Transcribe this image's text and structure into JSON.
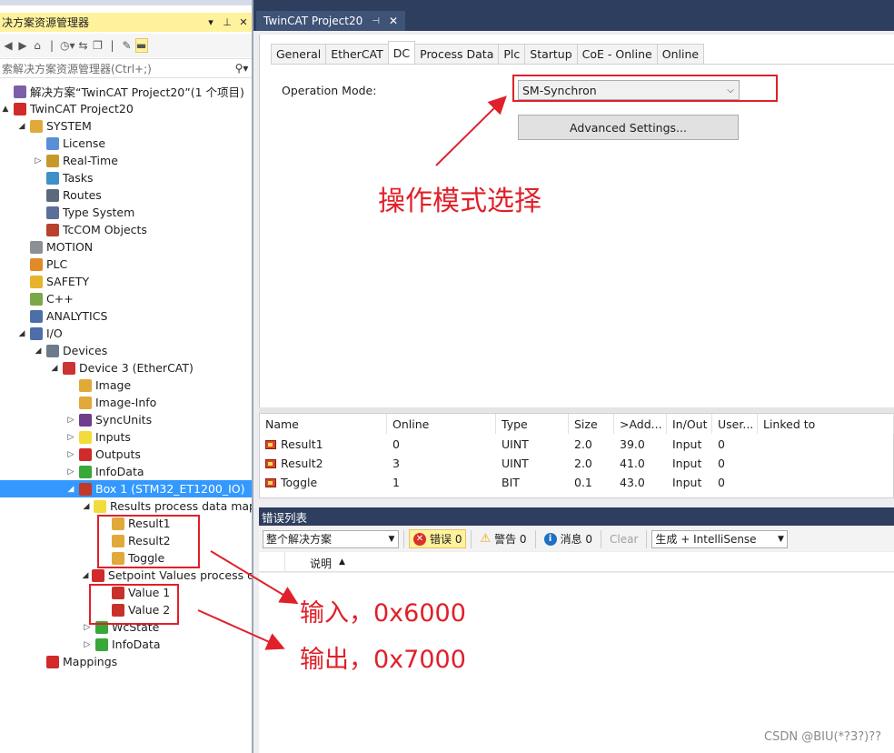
{
  "solution_explorer": {
    "title": "决方案资源管理器",
    "title_buttons": [
      "▾",
      "⊥",
      "✕"
    ],
    "toolbar_icons": [
      "back-icon",
      "forward-icon",
      "home-icon",
      "history-icon",
      "sync-icon",
      "collapse-icon",
      "properties-icon",
      "pin-preview-icon"
    ],
    "search_placeholder": "索解决方案资源管理器(Ctrl+;)",
    "tree": [
      {
        "label": "解决方案“TwinCAT Project20”(1 个项目)",
        "indent": 0,
        "toggle": "",
        "icon": "solution-icon",
        "color": "#7b5fa8"
      },
      {
        "label": "TwinCAT Project20",
        "indent": 0,
        "toggle": "▲",
        "icon": "project-icon",
        "color": "#d22a2a"
      },
      {
        "label": "SYSTEM",
        "indent": 1,
        "toggle": "◢",
        "icon": "system-icon",
        "color": "#e0a93a"
      },
      {
        "label": "License",
        "indent": 2,
        "toggle": "",
        "icon": "license-icon",
        "color": "#5a8fd6"
      },
      {
        "label": "Real-Time",
        "indent": 2,
        "toggle": "▷",
        "icon": "realtime-icon",
        "color": "#c59a2b"
      },
      {
        "label": "Tasks",
        "indent": 2,
        "toggle": "",
        "icon": "tasks-icon",
        "color": "#3f8fc9"
      },
      {
        "label": "Routes",
        "indent": 2,
        "toggle": "",
        "icon": "routes-icon",
        "color": "#5a6a7a"
      },
      {
        "label": "Type System",
        "indent": 2,
        "toggle": "",
        "icon": "type-system-icon",
        "color": "#5a6f9a"
      },
      {
        "label": "TcCOM Objects",
        "indent": 2,
        "toggle": "",
        "icon": "tccom-icon",
        "color": "#b8412f"
      },
      {
        "label": "MOTION",
        "indent": 1,
        "toggle": "",
        "icon": "motion-icon",
        "color": "#8b8f96"
      },
      {
        "label": "PLC",
        "indent": 1,
        "toggle": "",
        "icon": "plc-icon",
        "color": "#e08a2a"
      },
      {
        "label": "SAFETY",
        "indent": 1,
        "toggle": "",
        "icon": "safety-icon",
        "color": "#e8b32c"
      },
      {
        "label": "C++",
        "indent": 1,
        "toggle": "",
        "icon": "cpp-icon",
        "color": "#7aa848"
      },
      {
        "label": "ANALYTICS",
        "indent": 1,
        "toggle": "",
        "icon": "analytics-icon",
        "color": "#4d6fa8"
      },
      {
        "label": "I/O",
        "indent": 1,
        "toggle": "◢",
        "icon": "io-icon",
        "color": "#4d6fa8"
      },
      {
        "label": "Devices",
        "indent": 2,
        "toggle": "◢",
        "icon": "devices-icon",
        "color": "#6b7b8c"
      },
      {
        "label": "Device 3 (EtherCAT)",
        "indent": 3,
        "toggle": "◢",
        "icon": "ethercat-icon",
        "color": "#cc3333"
      },
      {
        "label": "Image",
        "indent": 4,
        "toggle": "",
        "icon": "image-icon",
        "color": "#e0a93a"
      },
      {
        "label": "Image-Info",
        "indent": 4,
        "toggle": "",
        "icon": "image-info-icon",
        "color": "#e0a93a"
      },
      {
        "label": "SyncUnits",
        "indent": 4,
        "toggle": "▷",
        "icon": "syncunits-icon",
        "color": "#6e3d8c"
      },
      {
        "label": "Inputs",
        "indent": 4,
        "toggle": "▷",
        "icon": "inputs-icon",
        "color": "#f2dc3c"
      },
      {
        "label": "Outputs",
        "indent": 4,
        "toggle": "▷",
        "icon": "outputs-icon",
        "color": "#d02a2a"
      },
      {
        "label": "InfoData",
        "indent": 4,
        "toggle": "▷",
        "icon": "infodata-icon",
        "color": "#38a838"
      },
      {
        "label": "Box 1 (STM32_ET1200_IO)",
        "indent": 4,
        "toggle": "◢",
        "icon": "box-icon",
        "color": "#c03a2a",
        "selected": true
      },
      {
        "label": "Results process data mapping",
        "indent": 5,
        "toggle": "◢",
        "icon": "inputs-folder-icon",
        "color": "#f2dc3c"
      },
      {
        "label": "Result1",
        "indent": 6,
        "toggle": "",
        "icon": "input-var-icon",
        "color": "#e0a93a"
      },
      {
        "label": "Result2",
        "indent": 6,
        "toggle": "",
        "icon": "input-var-icon",
        "color": "#e0a93a"
      },
      {
        "label": "Toggle",
        "indent": 6,
        "toggle": "",
        "icon": "input-var-icon",
        "color": "#e0a93a"
      },
      {
        "label": "Setpoint Values process data mapping",
        "indent": 5,
        "toggle": "◢",
        "icon": "outputs-folder-icon",
        "color": "#d02a2a"
      },
      {
        "label": "Value 1",
        "indent": 6,
        "toggle": "",
        "icon": "output-var-icon",
        "color": "#c8312a"
      },
      {
        "label": "Value 2",
        "indent": 6,
        "toggle": "",
        "icon": "output-var-icon",
        "color": "#c8312a"
      },
      {
        "label": "WcState",
        "indent": 5,
        "toggle": "▷",
        "icon": "wcstate-icon",
        "color": "#38a838"
      },
      {
        "label": "InfoData",
        "indent": 5,
        "toggle": "▷",
        "icon": "infodata-icon",
        "color": "#38a838"
      },
      {
        "label": "Mappings",
        "indent": 2,
        "toggle": "",
        "icon": "mappings-icon",
        "color": "#d02a2a"
      }
    ]
  },
  "document": {
    "tab_label": "TwinCAT Project20",
    "tab_pin": "⊣",
    "tab_close": "✕",
    "device_tabs": [
      "General",
      "EtherCAT",
      "DC",
      "Process Data",
      "Plc",
      "Startup",
      "CoE - Online",
      "Online"
    ],
    "active_tab": "DC",
    "operation_mode_label": "Operation Mode:",
    "operation_mode_value": "SM-Synchron",
    "advanced_button": "Advanced Settings..."
  },
  "variable_grid": {
    "columns": [
      "Name",
      "Online",
      "Type",
      "Size",
      ">Add...",
      "In/Out",
      "User...",
      "Linked to"
    ],
    "rows": [
      {
        "name": "Result1",
        "online": "0",
        "type": "UINT",
        "size": "2.0",
        "addr": "39.0",
        "inout": "Input",
        "user": "0",
        "linked": ""
      },
      {
        "name": "Result2",
        "online": "3",
        "type": "UINT",
        "size": "2.0",
        "addr": "41.0",
        "inout": "Input",
        "user": "0",
        "linked": ""
      },
      {
        "name": "Toggle",
        "online": "1",
        "type": "BIT",
        "size": "0.1",
        "addr": "43.0",
        "inout": "Input",
        "user": "0",
        "linked": ""
      }
    ]
  },
  "error_list": {
    "title": "错误列表",
    "scope": "整个解决方案",
    "errors": "错误 0",
    "warnings": "警告 0",
    "messages": "消息 0",
    "clear": "Clear",
    "build_filter": "生成 + IntelliSense",
    "column_desc": "说明"
  },
  "annotations": {
    "operation_mode": "操作模式选择",
    "input": "输入，0x6000",
    "output": "输出，0x7000"
  },
  "watermark": "CSDN @BIU(*?3?)??",
  "colors": {
    "accent_yellow": "#fff29d",
    "selection_blue": "#3399ff",
    "title_navy": "#2d3e5e",
    "annotation_red": "#e0202a"
  }
}
